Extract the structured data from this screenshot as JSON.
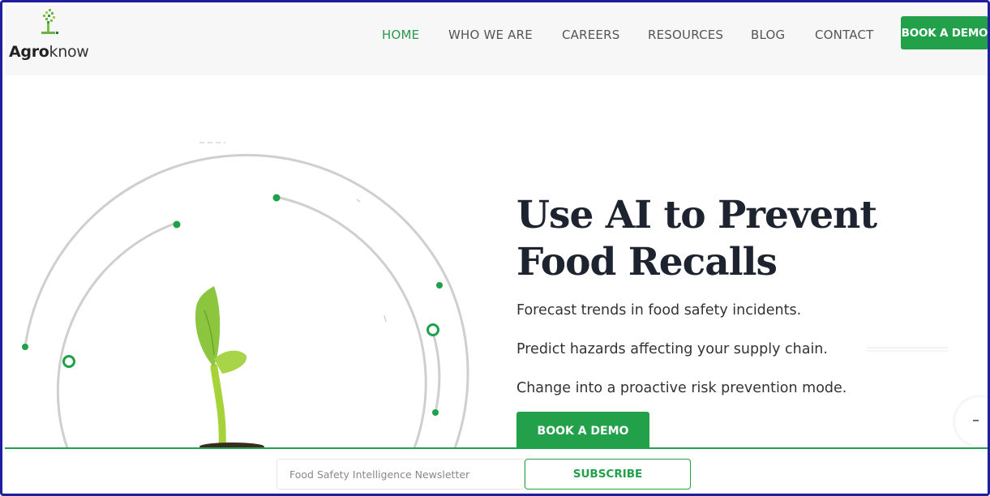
{
  "brand": {
    "logo_bold": "Agro",
    "logo_rest": "know",
    "accent_color": "#22a04a",
    "logo_icon": "sprout-pixel-icon"
  },
  "nav": {
    "items": [
      {
        "label": "HOME",
        "active": true
      },
      {
        "label": "WHO WE ARE",
        "active": false
      },
      {
        "label": "CAREERS",
        "active": false
      },
      {
        "label": "RESOURCES",
        "active": false
      },
      {
        "label": "BLOG",
        "active": false
      },
      {
        "label": "CONTACT",
        "active": false
      }
    ],
    "cta_label": "BOOK A DEMO"
  },
  "hero": {
    "headline": "Use AI to Prevent Food Recalls",
    "lines": [
      "Forecast trends in food safety incidents.",
      "Predict hazards affecting your supply chain.",
      "Change into a proactive risk prevention mode."
    ],
    "cta_label": "BOOK A DEMO",
    "image_icon": "seedling-icon"
  },
  "scroll_control": {
    "icon": "minus-icon",
    "symbol": "–"
  },
  "newsletter": {
    "placeholder": "Food Safety Intelligence Newsletter",
    "button_label": "SUBSCRIBE"
  }
}
